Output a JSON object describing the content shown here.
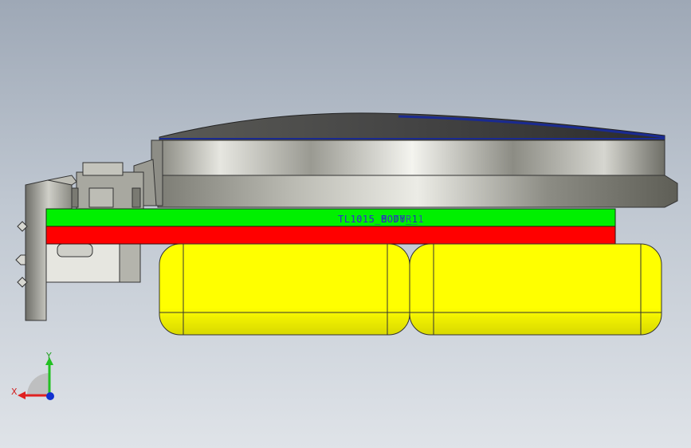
{
  "viewport": {
    "component_label_a": "TL1015_BODY_1",
    "component_label_b": "TL1015_MOTOR_1"
  },
  "triad": {
    "y_axis": "Y",
    "x_axis": "X"
  },
  "colors": {
    "green_plate": "#00f000",
    "red_plate": "#ff0000",
    "yellow_pad": "#ffff00",
    "label_blue": "#1e2fb0",
    "axis_y": "#22c022",
    "axis_x": "#e02020",
    "axis_z": "#1030d0"
  },
  "icons": [
    "coordinate-triad-icon"
  ]
}
